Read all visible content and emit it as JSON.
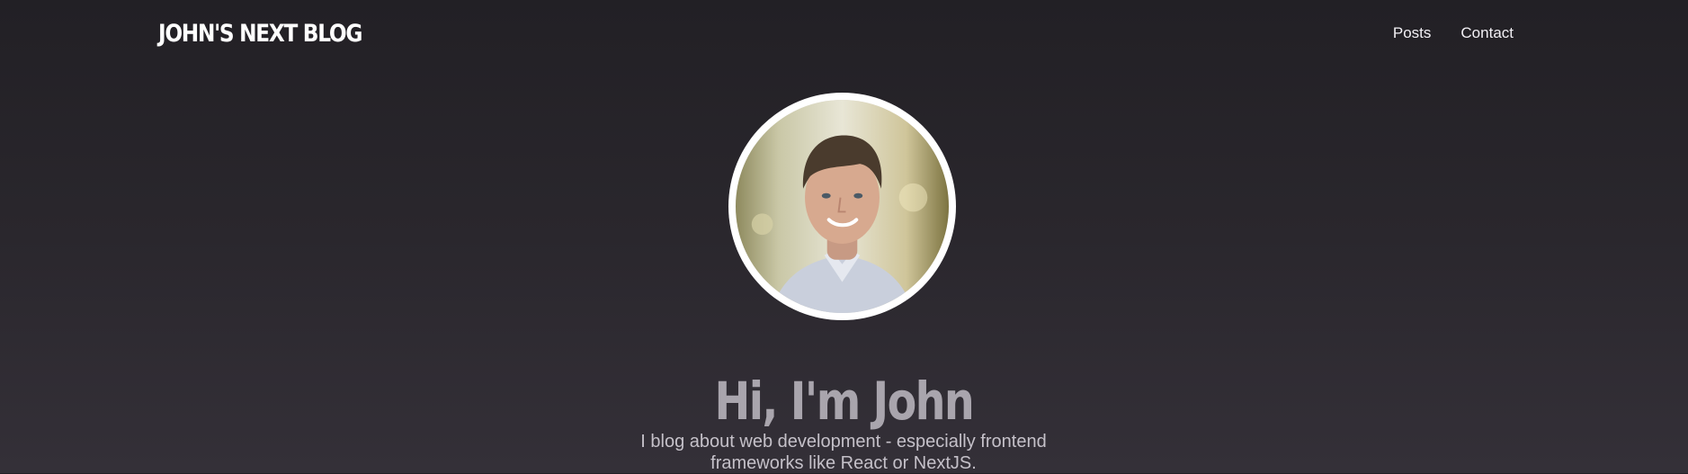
{
  "header": {
    "logo_text": "John's Next Blog",
    "nav": [
      {
        "label": "Posts"
      },
      {
        "label": "Contact"
      }
    ]
  },
  "hero": {
    "avatar_icon": "profile-photo",
    "title": "Hi, I'm John",
    "subtitle": "I blog about web development - especially frontend frameworks like React or NextJS."
  },
  "colors": {
    "background_top": "#222025",
    "background_bottom": "#343038",
    "title": "#a9a5ad",
    "subtitle": "#c5c1c9",
    "nav_text": "#f2f0f5",
    "logo_text": "#ffffff"
  }
}
